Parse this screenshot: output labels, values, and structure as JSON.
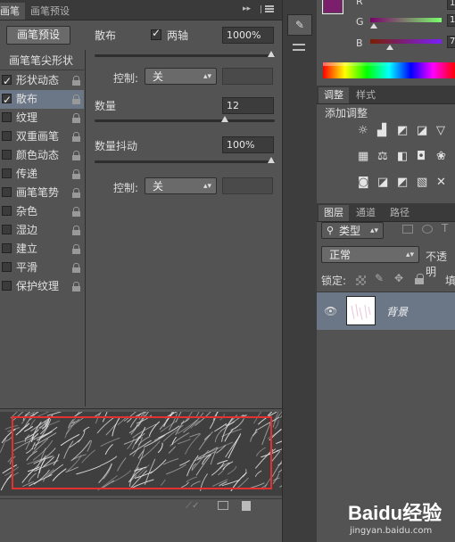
{
  "brush_panel": {
    "tabs": [
      "画笔",
      "画笔预设"
    ],
    "preset_button": "画笔预设",
    "section_header": "画笔笔尖形状",
    "items": [
      {
        "label": "形状动态",
        "checked": true,
        "selected": false
      },
      {
        "label": "散布",
        "checked": true,
        "selected": true
      },
      {
        "label": "纹理",
        "checked": false,
        "selected": false
      },
      {
        "label": "双重画笔",
        "checked": false,
        "selected": false
      },
      {
        "label": "颜色动态",
        "checked": false,
        "selected": false
      },
      {
        "label": "传递",
        "checked": false,
        "selected": false
      },
      {
        "label": "画笔笔势",
        "checked": false,
        "selected": false
      },
      {
        "label": "杂色",
        "checked": false,
        "selected": false
      },
      {
        "label": "湿边",
        "checked": false,
        "selected": false
      },
      {
        "label": "建立",
        "checked": false,
        "selected": false
      },
      {
        "label": "平滑",
        "checked": false,
        "selected": false
      },
      {
        "label": "保护纹理",
        "checked": false,
        "selected": false
      }
    ],
    "scatter": {
      "label": "散布",
      "both_axes_label": "两轴",
      "both_axes_checked": true,
      "value": "1000%",
      "slider_fraction": 1.0,
      "control_label": "控制:",
      "control_value": "关"
    },
    "count": {
      "label": "数量",
      "value": "12",
      "slider_fraction": 0.73
    },
    "count_jitter": {
      "label": "数量抖动",
      "value": "100%",
      "slider_fraction": 1.0,
      "control_label": "控制:",
      "control_value": "关"
    },
    "preview_highlight_color": "#e53030"
  },
  "color_panel": {
    "channels": [
      {
        "label": "R",
        "value": "1"
      },
      {
        "label": "G",
        "value": "1"
      },
      {
        "label": "B",
        "value": "7"
      }
    ],
    "swatch_color": "#7b1e6b"
  },
  "adjustments_panel": {
    "tabs": [
      "调整",
      "样式"
    ],
    "title": "添加调整"
  },
  "layers_panel": {
    "tabs": [
      "图层",
      "通道",
      "路径"
    ],
    "filter_label": "类型",
    "blend_mode": "正常",
    "opacity_label": "不透明",
    "lock_label": "锁定:",
    "fill_label": "填",
    "layer_name": "背景"
  },
  "watermark": {
    "text": "Baidu经验",
    "url": "jingyan.baidu.com"
  }
}
